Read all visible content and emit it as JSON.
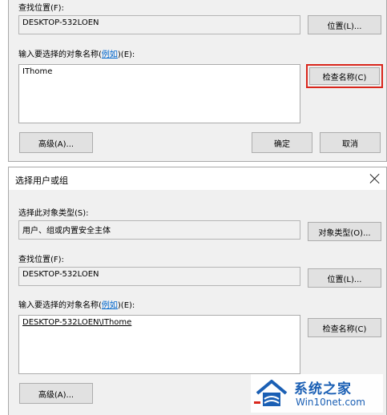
{
  "dialog_top": {
    "location_label": "查找位置(F):",
    "location_value": "DESKTOP-532LOEN",
    "location_button": "位置(L)...",
    "names_label_prefix": "输入要选择的对象名称(",
    "names_label_link": "例如",
    "names_label_suffix": ")(E):",
    "names_value": "IThome",
    "check_names_button": "检查名称(C)",
    "advanced_button": "高级(A)...",
    "ok_button": "确定",
    "cancel_button": "取消"
  },
  "dialog_bottom": {
    "title": "选择用户或组",
    "object_type_label": "选择此对象类型(S):",
    "object_type_value": "用户、组或内置安全主体",
    "object_type_button": "对象类型(O)...",
    "location_label": "查找位置(F):",
    "location_value": "DESKTOP-532LOEN",
    "location_button": "位置(L)...",
    "names_label_prefix": "输入要选择的对象名称(",
    "names_label_link": "例如",
    "names_label_suffix": ")(E):",
    "names_value": "DESKTOP-532LOEN\\IThome",
    "check_names_button": "检查名称(C)",
    "advanced_button": "高级(A)..."
  },
  "watermark": {
    "title": "系统之家",
    "url": "Win10net.com"
  },
  "colors": {
    "highlight": "#d9261c",
    "link": "#0066cc",
    "watermark": "#1a5fb4"
  }
}
